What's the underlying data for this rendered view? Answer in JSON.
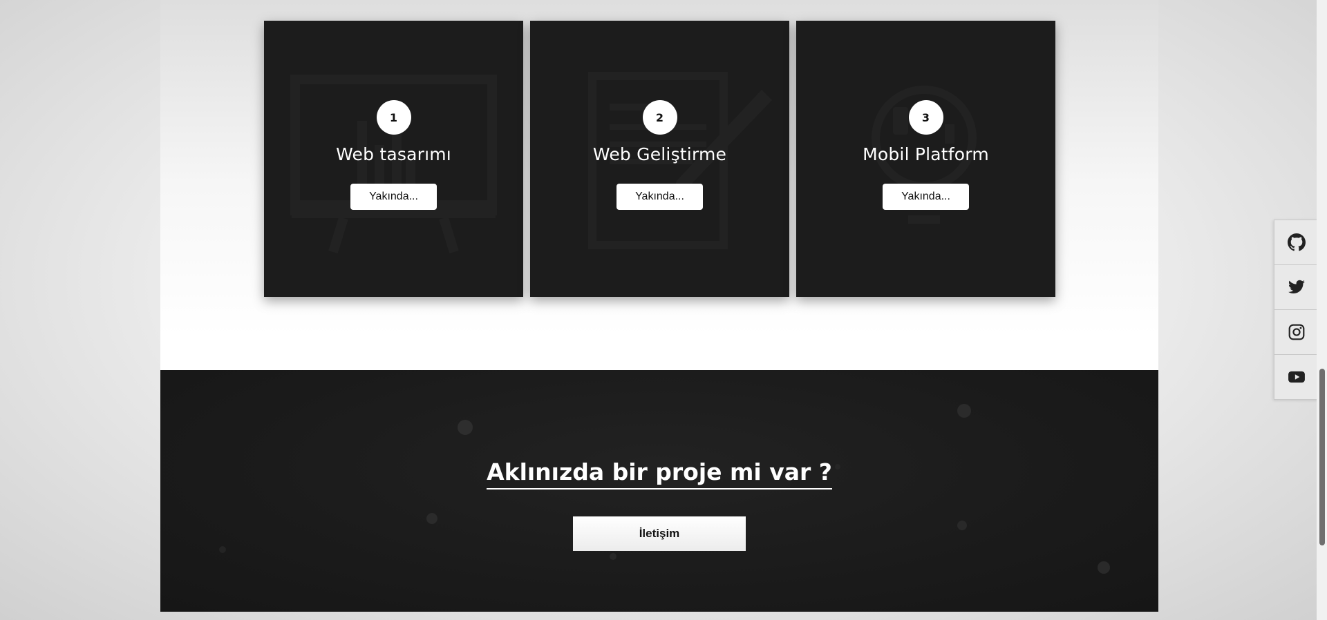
{
  "cards": [
    {
      "number": "1",
      "title": "Web tasarımı",
      "button_label": "Yakında...",
      "bg_icon": "presentation-chart-icon"
    },
    {
      "number": "2",
      "title": "Web Geliştirme",
      "button_label": "Yakında...",
      "bg_icon": "document-pen-icon"
    },
    {
      "number": "3",
      "title": "Mobil Platform",
      "button_label": "Yakında...",
      "bg_icon": "mobile-idea-icon"
    }
  ],
  "cta": {
    "heading": "Aklınızda bir proje mi var ?",
    "button_label": "İletişim"
  },
  "social": [
    {
      "name": "github",
      "icon": "github-icon"
    },
    {
      "name": "twitter",
      "icon": "twitter-icon"
    },
    {
      "name": "instagram",
      "icon": "instagram-icon"
    },
    {
      "name": "youtube",
      "icon": "youtube-icon"
    }
  ],
  "colors": {
    "card_bg": "#1c1c1c",
    "accent_white": "#ffffff",
    "cta_bg": "#1b1b1b"
  }
}
